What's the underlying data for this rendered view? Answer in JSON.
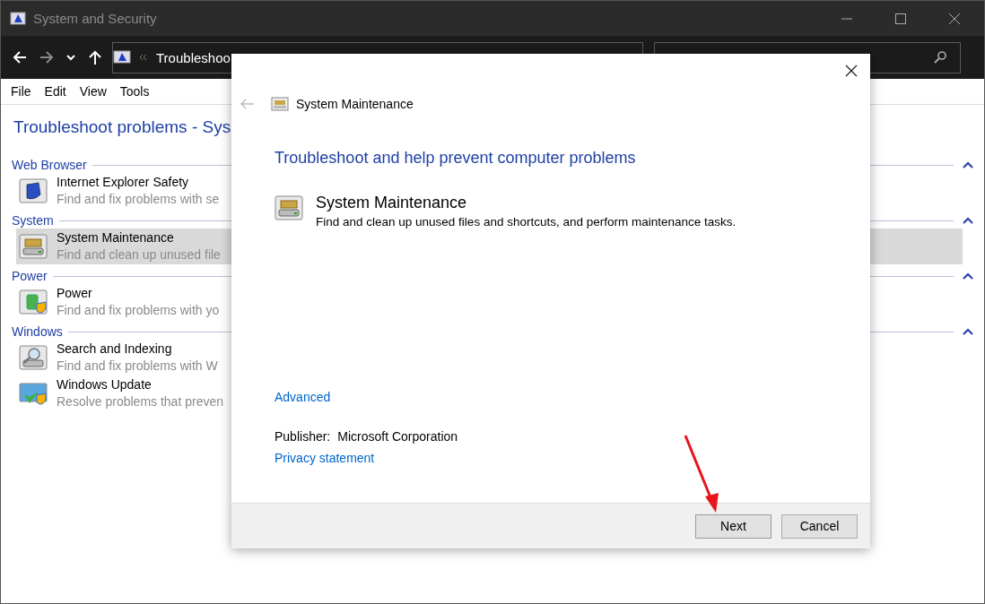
{
  "window": {
    "title": "System and Security"
  },
  "nav": {
    "breadcrumb": "Troubleshoo"
  },
  "menu": [
    "File",
    "Edit",
    "View",
    "Tools"
  ],
  "page_title": "Troubleshoot problems - Sys",
  "groups": [
    {
      "title": "Web Browser",
      "items": [
        {
          "name": "Internet Explorer Safety",
          "description": "Find and fix problems with se",
          "selected": false
        }
      ]
    },
    {
      "title": "System",
      "items": [
        {
          "name": "System Maintenance",
          "description": "Find and clean up unused file",
          "selected": true
        }
      ]
    },
    {
      "title": "Power",
      "items": [
        {
          "name": "Power",
          "description": "Find and fix problems with yo",
          "selected": false
        }
      ]
    },
    {
      "title": "Windows",
      "items": [
        {
          "name": "Search and Indexing",
          "description": "Find and fix problems with W",
          "selected": false
        },
        {
          "name": "Windows Update",
          "description": "Resolve problems that preven",
          "selected": false
        }
      ]
    }
  ],
  "dialog": {
    "title": "System Maintenance",
    "heading": "Troubleshoot and help prevent computer problems",
    "task": {
      "name": "System Maintenance",
      "description": "Find and clean up unused files and shortcuts, and perform maintenance tasks."
    },
    "advanced": "Advanced",
    "publisher_label": "Publisher:",
    "publisher": "Microsoft Corporation",
    "privacy": "Privacy statement",
    "buttons": [
      {
        "label": "Next",
        "kind": "primary"
      },
      {
        "label": "Cancel",
        "kind": "normal"
      }
    ]
  }
}
